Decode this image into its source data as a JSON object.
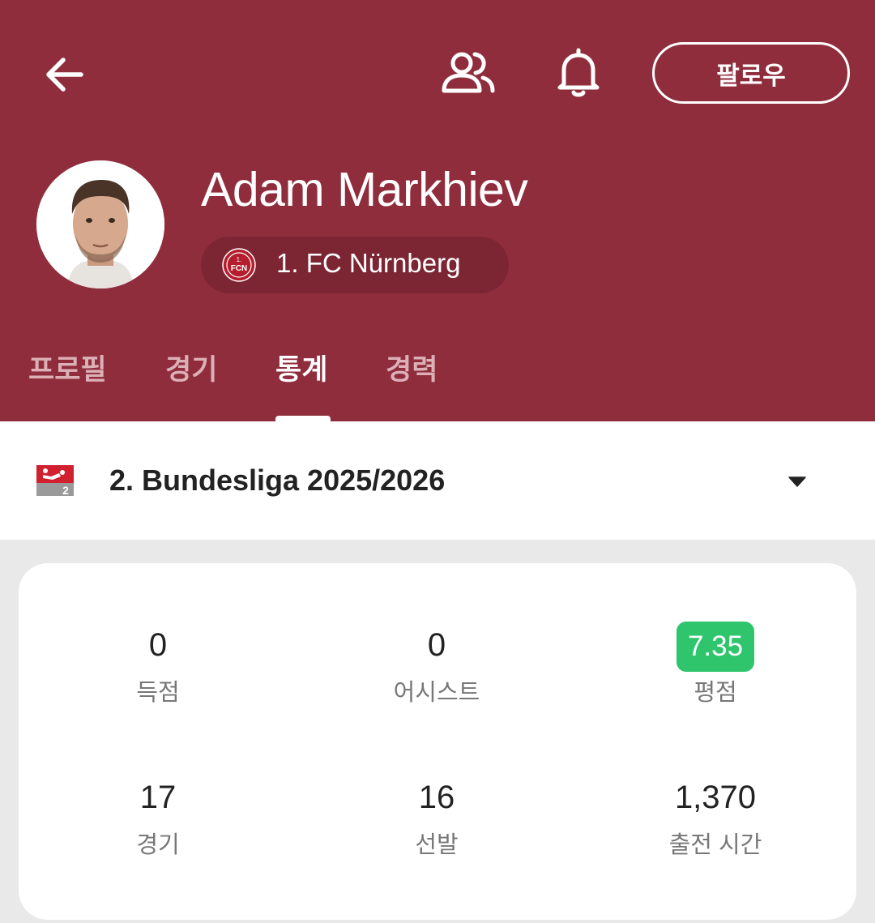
{
  "header": {
    "follow_label": "팔로우",
    "icons": {
      "back": "arrow-left-icon",
      "people": "people-icon",
      "bell": "bell-icon"
    },
    "background_color": "#8f2d3c"
  },
  "player": {
    "name": "Adam Markhiev",
    "team": "1. FC Nürnberg"
  },
  "tabs": [
    {
      "label": "프로필",
      "active": false
    },
    {
      "label": "경기",
      "active": false
    },
    {
      "label": "통계",
      "active": true
    },
    {
      "label": "경력",
      "active": false
    }
  ],
  "league_selector": {
    "name": "2. Bundesliga 2025/2026"
  },
  "stats": [
    {
      "value": "0",
      "label": "득점"
    },
    {
      "value": "0",
      "label": "어시스트"
    },
    {
      "value": "7.35",
      "label": "평점",
      "badge_color": "#2ec56c"
    },
    {
      "value": "17",
      "label": "경기"
    },
    {
      "value": "16",
      "label": "선발"
    },
    {
      "value": "1,370",
      "label": "출전 시간"
    }
  ]
}
